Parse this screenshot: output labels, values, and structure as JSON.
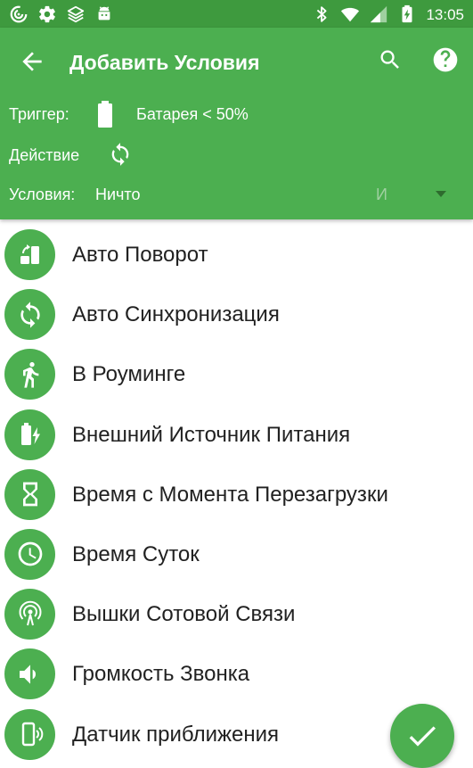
{
  "status_bar": {
    "time": "13:05",
    "left_icons": [
      "signal-swirl-icon",
      "gear-icon",
      "layers-icon",
      "android-icon"
    ],
    "right_icons": [
      "bluetooth-icon",
      "wifi-icon",
      "cell-signal-icon",
      "battery-charging-icon"
    ]
  },
  "app_bar": {
    "title": "Добавить Условия",
    "back_icon": "arrow-back-icon",
    "search_icon": "search-icon",
    "help_icon": "help-icon",
    "color": "#4caf50"
  },
  "summary": {
    "trigger_label": "Триггер:",
    "trigger_value": "Батарея < 50%",
    "trigger_icon": "battery-icon",
    "action_label": "Действие",
    "action_icon": "sync-icon",
    "conditions_label": "Условия:",
    "conditions_value": "Ничто",
    "logic_value": "И",
    "dropdown_icon": "dropdown-arrow-icon"
  },
  "conditions": [
    {
      "label": "Авто Поворот",
      "icon": "screen-rotation-icon"
    },
    {
      "label": "Авто Синхронизация",
      "icon": "sync-icon"
    },
    {
      "label": "В Роуминге",
      "icon": "walking-person-icon"
    },
    {
      "label": "Внешний Источник Питания",
      "icon": "battery-charging-icon"
    },
    {
      "label": "Время с Момента Перезагрузки",
      "icon": "hourglass-icon"
    },
    {
      "label": "Время Суток",
      "icon": "clock-icon"
    },
    {
      "label": "Вышки Сотовой Связи",
      "icon": "cell-tower-icon"
    },
    {
      "label": "Громкость Звонка",
      "icon": "volume-icon"
    },
    {
      "label": "Датчик приближения",
      "icon": "proximity-sensor-icon"
    }
  ],
  "fab": {
    "icon": "check-icon"
  }
}
